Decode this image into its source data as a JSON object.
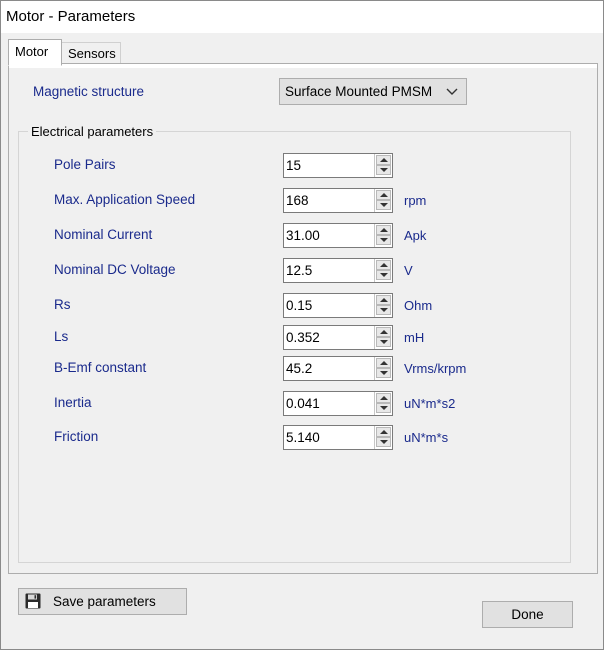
{
  "window": {
    "title": "Motor - Parameters"
  },
  "tabs": [
    {
      "label": "Motor",
      "active": true
    },
    {
      "label": "Sensors",
      "active": false
    }
  ],
  "magnetic": {
    "label": "Magnetic structure",
    "selected": "Surface Mounted PMSM"
  },
  "electrical": {
    "group_title": "Electrical parameters",
    "params": [
      {
        "label": "Pole Pairs",
        "value": "15",
        "unit": ""
      },
      {
        "label": "Max. Application Speed",
        "value": "168",
        "unit": "rpm"
      },
      {
        "label": "Nominal Current",
        "value": "31.00",
        "unit": "Apk"
      },
      {
        "label": "Nominal DC Voltage",
        "value": "12.5",
        "unit": "V"
      },
      {
        "label": "Rs",
        "value": "0.15",
        "unit": "Ohm"
      },
      {
        "label": "Ls",
        "value": "0.352",
        "unit": "mH"
      },
      {
        "label": "B-Emf constant",
        "value": "45.2",
        "unit": "Vrms/krpm"
      },
      {
        "label": "Inertia",
        "value": "0.041",
        "unit": "uN*m*s2"
      },
      {
        "label": "Friction",
        "value": "5.140",
        "unit": "uN*m*s"
      }
    ]
  },
  "buttons": {
    "save_label": "Save parameters",
    "done_label": "Done"
  },
  "colors": {
    "label_blue": "#1a2a8c",
    "button_face": "#e1e1e1",
    "panel_bg": "#f0f0f0"
  },
  "icons": {
    "save": "floppy-disk-icon",
    "combo_arrow": "chevron-down-icon",
    "spin_up": "spin-up-arrow-icon",
    "spin_down": "spin-down-arrow-icon"
  }
}
